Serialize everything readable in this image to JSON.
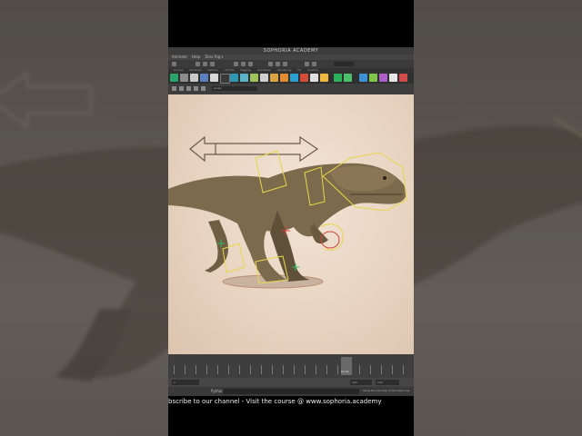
{
  "window": {
    "title": "SOPHORIA ACADEMY"
  },
  "menu": {
    "items": [
      "Animate",
      "Help",
      "Dino Rig's"
    ]
  },
  "shelf_tabs": [
    "Curves",
    "Surfaces",
    "Deform",
    "UV Edit",
    "Rigging",
    "Animation",
    "Rendering",
    "FX",
    "Custom"
  ],
  "panel": {
    "camera_field": "persp",
    "view_label": "persp"
  },
  "timeline": {
    "current_frame": "60.00"
  },
  "range": {
    "start": "1",
    "end": "120"
  },
  "command_line": {
    "label": "Python",
    "help": "Show the CG help in the Help Line"
  },
  "caption": {
    "text": "bscribe to our channel - Visit the course @ www.sophoria.academy"
  },
  "colors": {
    "viewport_bg": "#ead7c5",
    "rig_yellow": "#e8d64a",
    "ui_dark": "#3c3c3c"
  }
}
